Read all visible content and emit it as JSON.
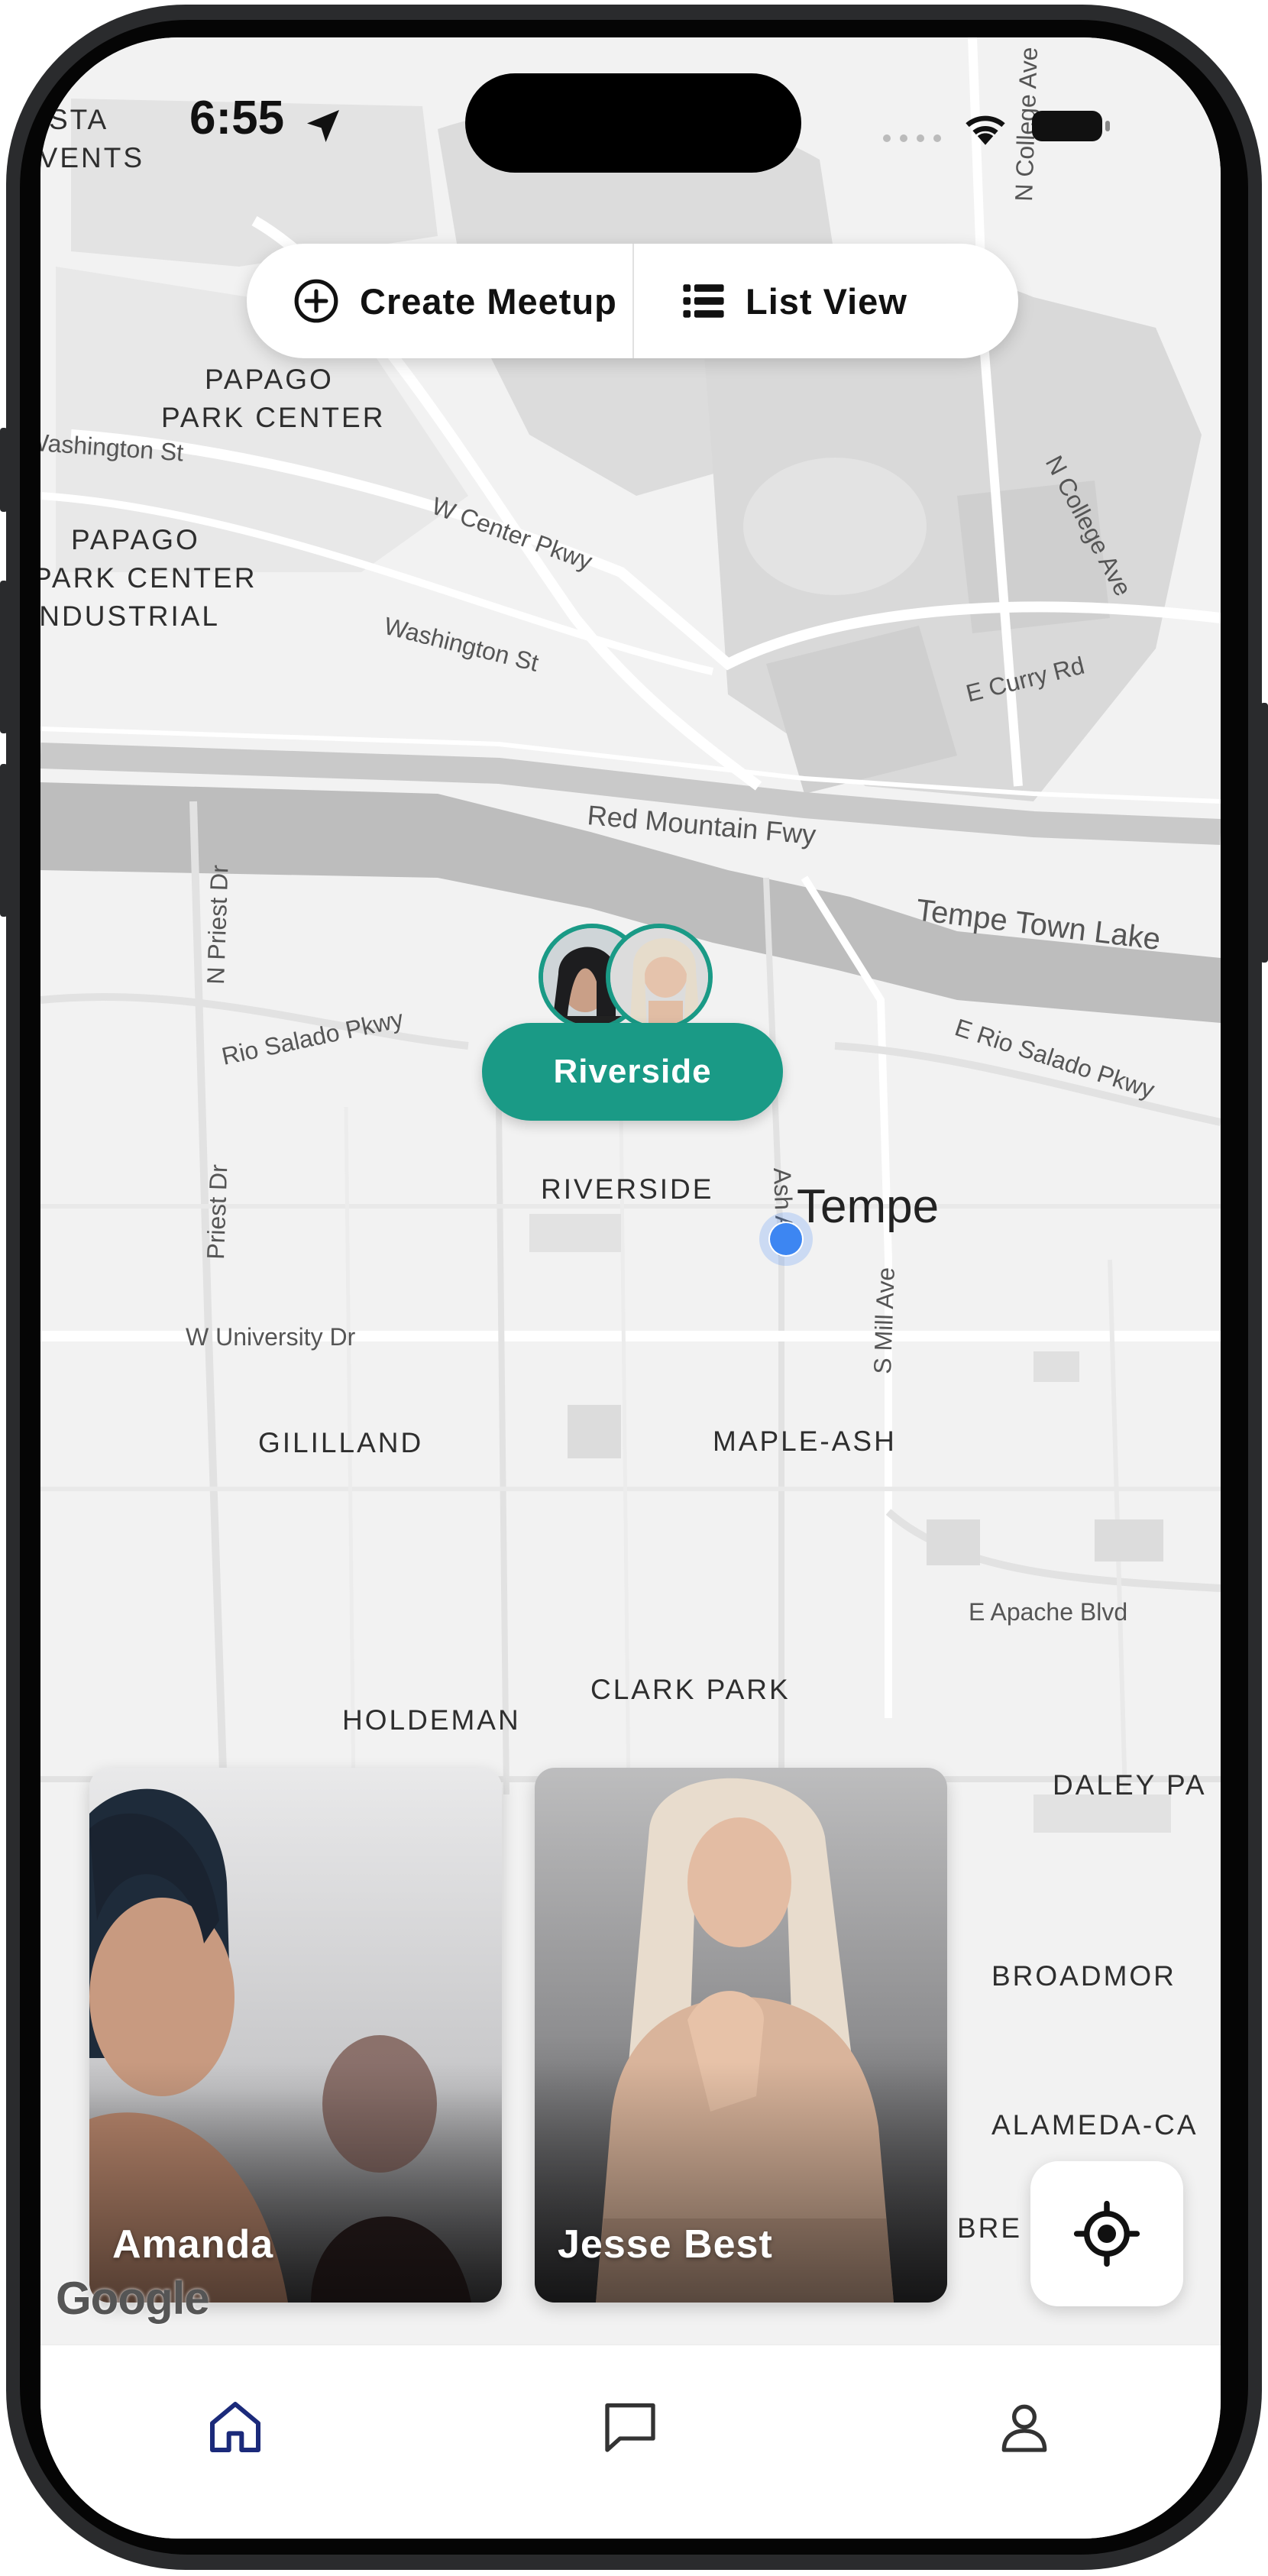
{
  "status_bar": {
    "time": "6:55",
    "icons": [
      "location-arrow-icon",
      "signal-dots-icon",
      "wifi-icon",
      "battery-icon"
    ]
  },
  "top_actions": {
    "create_meetup": {
      "label": "Create Meetup",
      "icon": "plus-circle-icon"
    },
    "list_view": {
      "label": "List View",
      "icon": "list-icon"
    }
  },
  "map": {
    "area_labels": [
      "VISTA",
      "EVENTS",
      "PAPAGO",
      "PARK CENTER",
      "PAPAGO",
      "PARK CENTER",
      "INDUSTRIAL",
      "RIVERSIDE",
      "GILILLAND",
      "MAPLE-ASH",
      "CLARK PARK",
      "HOLDEMAN",
      "DALEY PA",
      "BROADMOR",
      "ALAMEDA-CA",
      "BRE"
    ],
    "street_labels": [
      "N College Ave",
      "Washington St",
      "W Center Pkwy",
      "N College Ave",
      "Washington St",
      "E Curry Rd",
      "Red Mountain Fwy",
      "Tempe Town Lake",
      "N Priest Dr",
      "Rio Salado Pkwy",
      "E Rio Salado Pkwy",
      "Priest Dr",
      "Ash Ave",
      "S Mill Ave",
      "W University Dr",
      "E Apache Blvd"
    ],
    "city_label": "Tempe",
    "attribution": "Google",
    "marker": {
      "label": "Riverside",
      "color": "#1a9a86"
    }
  },
  "cards": [
    {
      "name": "Amanda"
    },
    {
      "name": "Jesse Best"
    }
  ],
  "locate_button": {
    "icon": "crosshair-icon"
  },
  "tab_bar": {
    "items": [
      {
        "icon": "home-icon",
        "active": true,
        "color": "#1b2a7a"
      },
      {
        "icon": "chat-icon",
        "active": false
      },
      {
        "icon": "profile-icon",
        "active": false
      }
    ]
  }
}
